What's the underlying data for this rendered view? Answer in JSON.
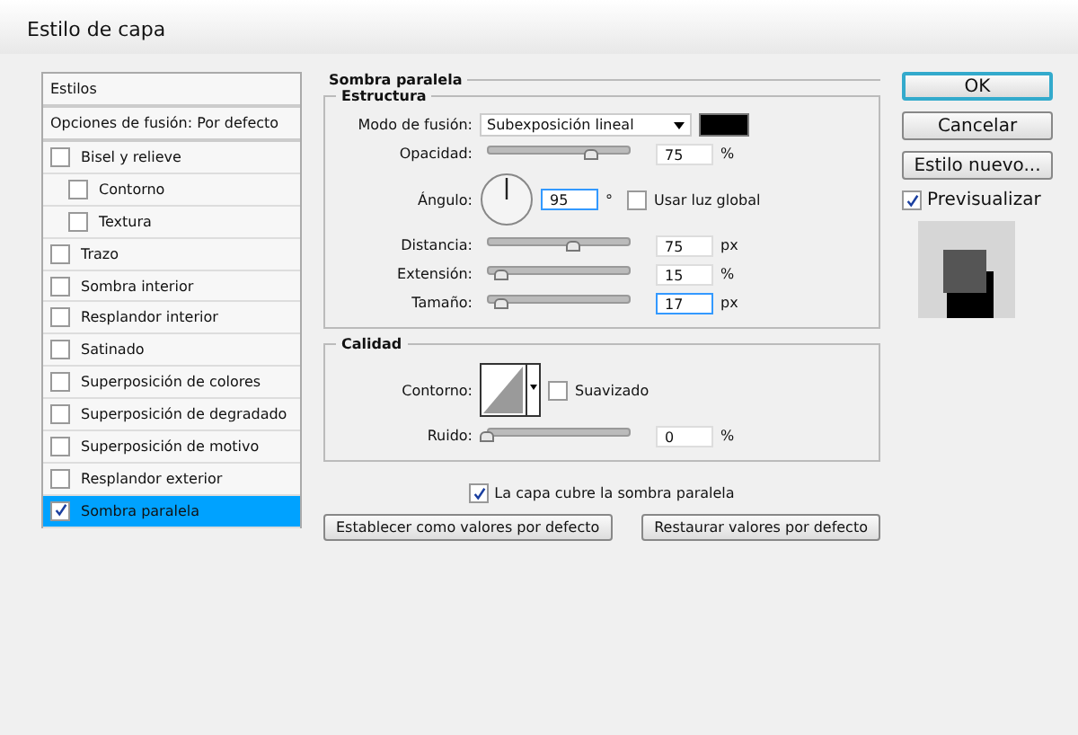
{
  "window": {
    "title": "Estilo de capa"
  },
  "sidebar": {
    "items": [
      {
        "kind": "header",
        "label": "Estilos",
        "selected": false
      },
      {
        "kind": "plain",
        "label": "Opciones de fusión: Por defecto",
        "selected": false
      },
      {
        "kind": "check",
        "label": "Bisel y relieve",
        "checked": false,
        "selected": false,
        "children": [
          {
            "kind": "check",
            "label": "Contorno",
            "checked": false,
            "selected": false
          },
          {
            "kind": "check",
            "label": "Textura",
            "checked": false,
            "selected": false
          }
        ]
      },
      {
        "kind": "check",
        "label": "Trazo",
        "checked": false,
        "selected": false
      },
      {
        "kind": "check",
        "label": "Sombra interior",
        "checked": false,
        "selected": false
      },
      {
        "kind": "check",
        "label": "Resplandor interior",
        "checked": false,
        "selected": false
      },
      {
        "kind": "check",
        "label": "Satinado",
        "checked": false,
        "selected": false
      },
      {
        "kind": "check",
        "label": "Superposición de colores",
        "checked": false,
        "selected": false
      },
      {
        "kind": "check",
        "label": "Superposición de degradado",
        "checked": false,
        "selected": false
      },
      {
        "kind": "check",
        "label": "Superposición de motivo",
        "checked": false,
        "selected": false
      },
      {
        "kind": "check",
        "label": "Resplandor exterior",
        "checked": false,
        "selected": false
      },
      {
        "kind": "check",
        "label": "Sombra paralela",
        "checked": true,
        "selected": true
      }
    ]
  },
  "panel": {
    "title": "Sombra paralela",
    "structure": {
      "title": "Estructura",
      "blend_mode": {
        "label": "Modo de fusión:",
        "value": "Subexposición lineal",
        "color": "#000000"
      },
      "opacity": {
        "label": "Opacidad:",
        "level": 0.72,
        "value": "75",
        "unit": "%"
      },
      "angle": {
        "label": "Ángulo:",
        "value": "95",
        "unit": "°",
        "global_light": {
          "label": "Usar luz global",
          "checked": false
        }
      },
      "sliders": [
        {
          "label": "Distancia:",
          "level": 0.6,
          "value": "75",
          "unit": "px",
          "focused": false
        },
        {
          "label": "Extensión:",
          "level": 0.1,
          "value": "15",
          "unit": "%",
          "focused": false
        },
        {
          "label": "Tamaño:",
          "level": 0.1,
          "value": "17",
          "unit": "px",
          "focused": true
        }
      ]
    },
    "quality": {
      "title": "Calidad",
      "contour_label": "Contorno:",
      "antialias": {
        "label": "Suavizado",
        "checked": false
      },
      "noise": {
        "label": "Ruido:",
        "level": 0,
        "value": "0",
        "unit": "%"
      }
    },
    "knockout": {
      "label": "La capa cubre la sombra paralela",
      "checked": true
    },
    "buttons": [
      "Establecer como valores por defecto",
      "Restaurar valores por defecto"
    ]
  },
  "actions": {
    "buttons": [
      {
        "label": "OK",
        "default": true
      },
      {
        "label": "Cancelar",
        "default": false
      },
      {
        "label": "Estilo nuevo...",
        "default": false
      }
    ],
    "preview": {
      "label": "Previsualizar",
      "checked": true
    }
  }
}
